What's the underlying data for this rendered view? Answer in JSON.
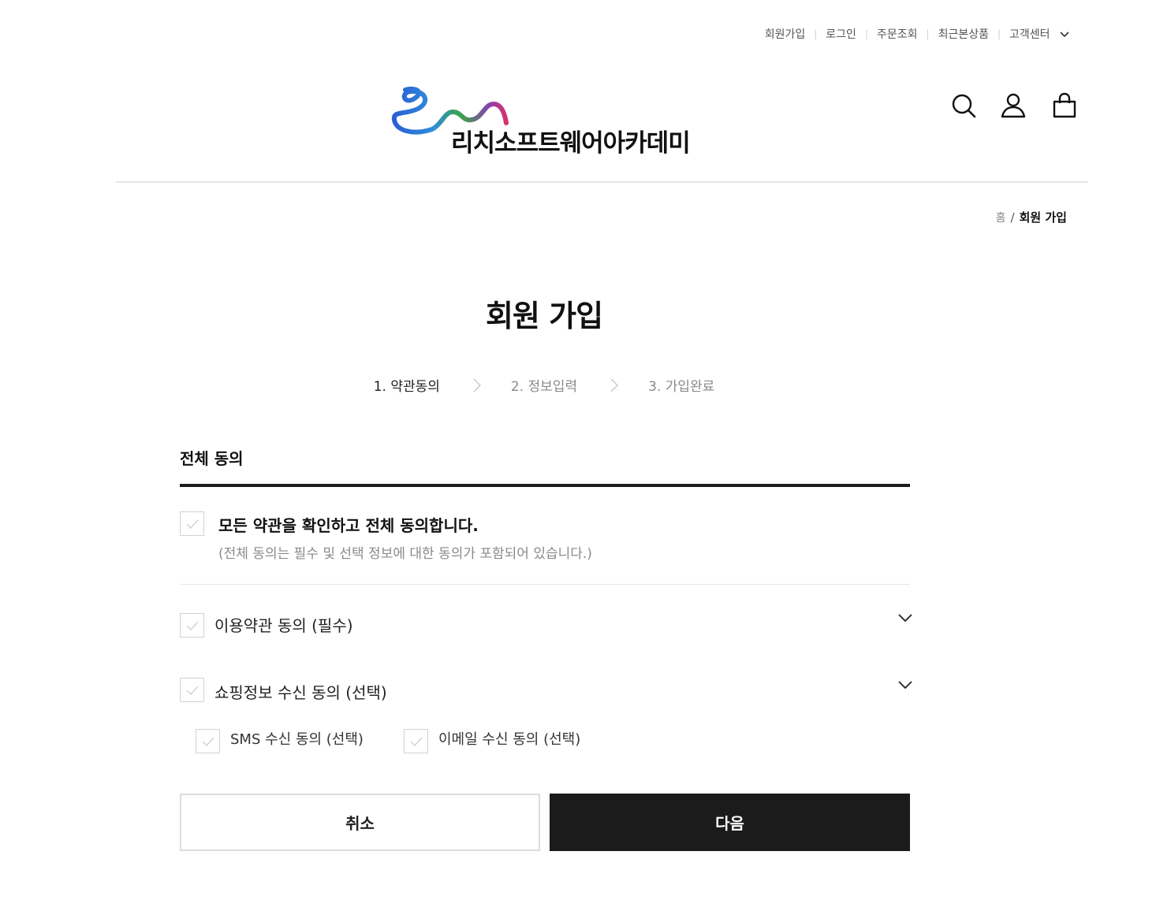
{
  "utility_nav": {
    "signup": "회원가입",
    "login": "로그인",
    "order_lookup": "주문조회",
    "recent_products": "최근본상품",
    "customer_center": "고객센터",
    "separator": "|"
  },
  "logo": {
    "text": "리치소프트웨어아카데미",
    "ribbon_colors": [
      "#2a5fd6",
      "#3aa34a",
      "#8a3fb0",
      "#d8306e"
    ]
  },
  "header_icons": [
    "search-icon",
    "user-icon",
    "shopping-bag-icon"
  ],
  "breadcrumb": {
    "home": "홈",
    "separator": "/",
    "current": "회원 가입"
  },
  "page_title": "회원 가입",
  "steps": [
    {
      "label": "1. 약관동의",
      "active": true
    },
    {
      "label": "2. 정보입력",
      "active": false
    },
    {
      "label": "3. 가입완료",
      "active": false
    }
  ],
  "agreement": {
    "section_title": "전체 동의",
    "all_agree_label": "모든 약관을 확인하고 전체 동의합니다.",
    "all_agree_desc": "(전체 동의는 필수 및 선택 정보에 대한 동의가 포함되어 있습니다.)",
    "terms_label": "이용약관 동의 (필수)",
    "shopping_label": "쇼핑정보 수신 동의 (선택)",
    "sms_label": "SMS 수신 동의 (선택)",
    "email_label": "이메일 수신 동의 (선택)"
  },
  "buttons": {
    "cancel": "취소",
    "next": "다음"
  },
  "colors": {
    "primary_button": "#1b1b1b",
    "divider": "#e6e6e6",
    "checkbox_border": "#d2d2d2",
    "muted_text": "#8a8a8a"
  }
}
